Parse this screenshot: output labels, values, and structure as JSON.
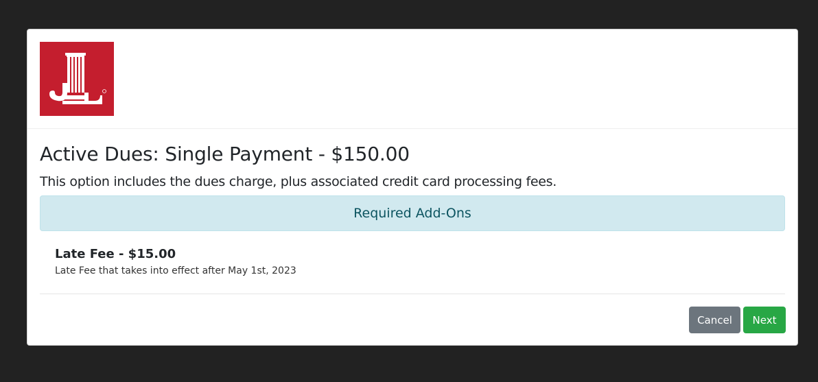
{
  "logo": {
    "alt_text": "JL",
    "color": "#c41e2e"
  },
  "modal": {
    "title": "Active Dues: Single Payment - $150.00",
    "subtitle": "This option includes the dues charge, plus associated credit card processing fees.",
    "addons_heading": "Required Add-Ons",
    "addons": [
      {
        "name": "Late Fee - $15.00",
        "description": "Late Fee that takes into effect after May 1st, 2023"
      }
    ],
    "buttons": {
      "cancel": "Cancel",
      "next": "Next"
    }
  },
  "colors": {
    "cancel": "#6c757d",
    "next": "#28a745",
    "banner_bg": "#d1e9ef",
    "banner_text": "#0c5460"
  }
}
